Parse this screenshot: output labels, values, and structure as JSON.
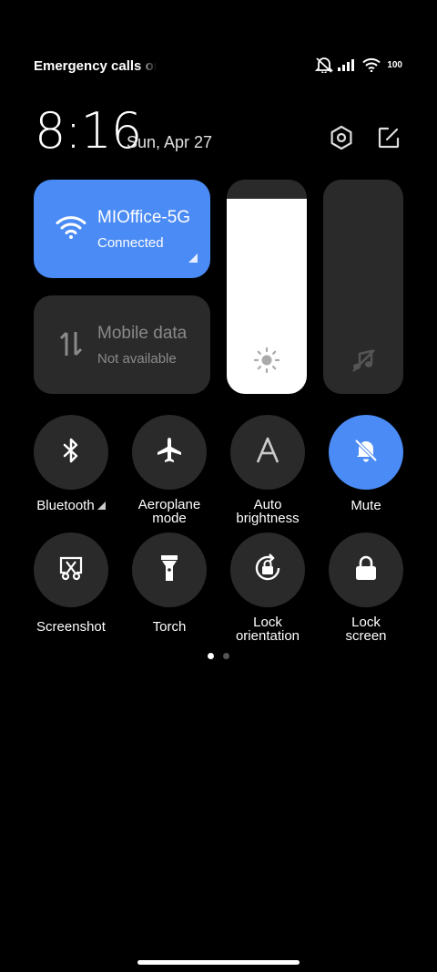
{
  "status_bar": {
    "carrier": "Emergency calls only",
    "battery": "100",
    "icons": [
      "silent-icon",
      "signal-icon",
      "wifi-icon"
    ]
  },
  "header": {
    "time": "8:16",
    "date": "Sun, Apr 27",
    "icons": [
      "settings-icon",
      "edit-icon"
    ]
  },
  "tiles": {
    "wifi": {
      "title": "MIOffice-5G",
      "subtitle": "Connected",
      "active": true
    },
    "mobile_data": {
      "title": "Mobile data",
      "subtitle": "Not available",
      "active": false
    }
  },
  "sliders": {
    "brightness": {
      "level": 0.91,
      "icon": "sun-icon"
    },
    "volume": {
      "level": 0.0,
      "icon": "music-muted-icon"
    }
  },
  "toggles": [
    {
      "label": "Bluetooth",
      "icon": "bluetooth-icon",
      "active": false
    },
    {
      "label": "Aeroplane mode",
      "icon": "airplane-icon",
      "active": false
    },
    {
      "label": "Auto brightness",
      "icon": "auto-brightness-icon",
      "active": false
    },
    {
      "label": "Mute",
      "icon": "bell-off-icon",
      "active": true
    },
    {
      "label": "Screenshot",
      "icon": "screenshot-icon",
      "active": false
    },
    {
      "label": "Torch",
      "icon": "torch-icon",
      "active": false
    },
    {
      "label": "Lock orientation",
      "icon": "rotation-lock-icon",
      "active": false
    },
    {
      "label": "Lock screen",
      "icon": "lock-icon",
      "active": false
    }
  ],
  "pager": {
    "current": 1,
    "total": 2
  },
  "colors": {
    "accent": "#4b8bf5",
    "tile_bg": "#2a2a2a",
    "background": "#000000"
  }
}
